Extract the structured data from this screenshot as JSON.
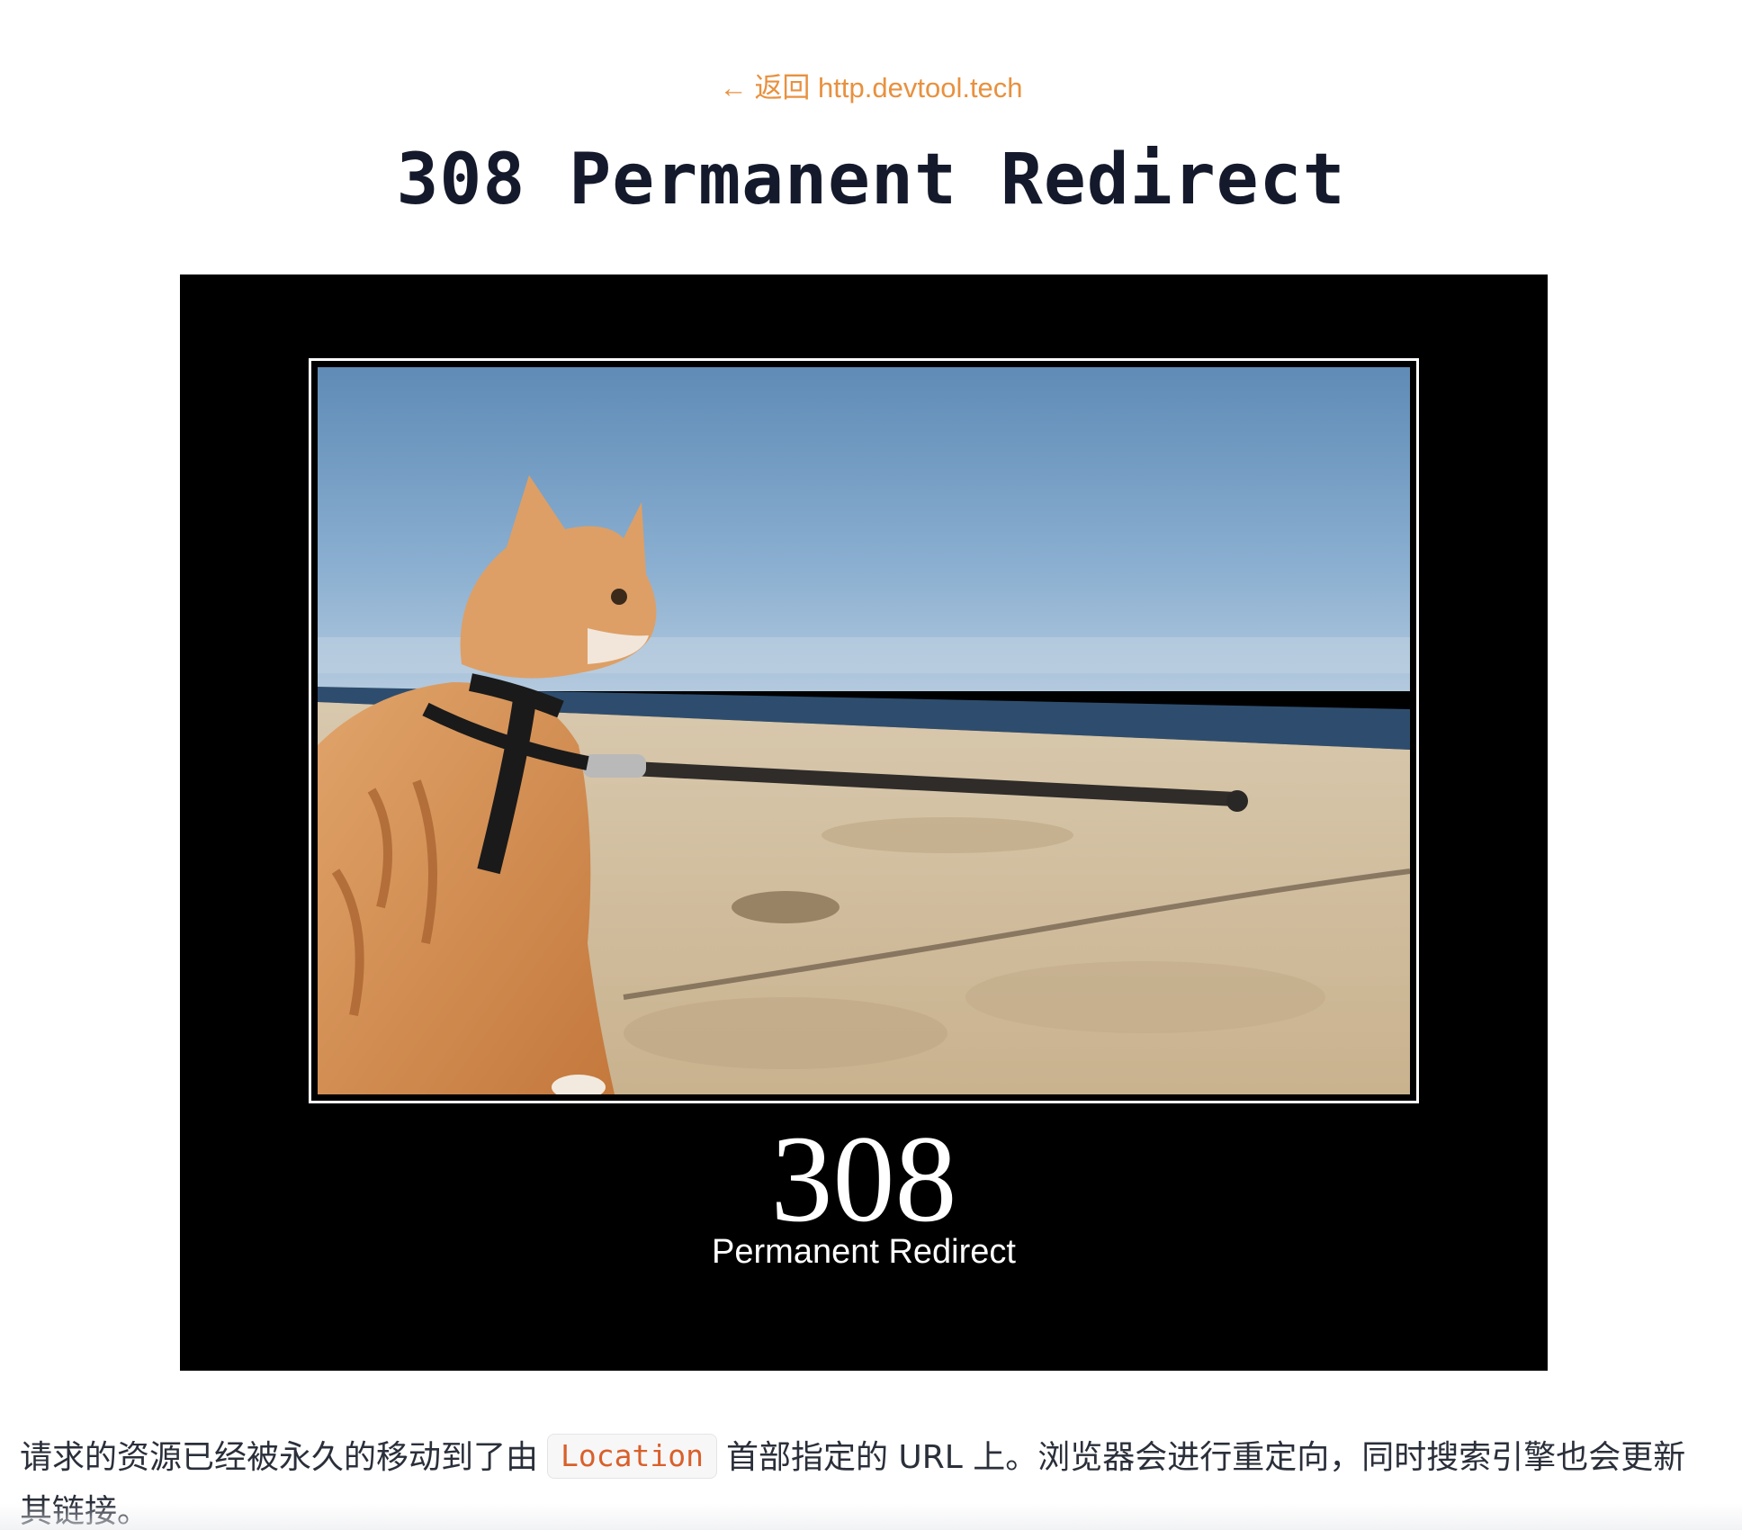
{
  "nav": {
    "back_arrow": "←",
    "back_label": "返回 http.devtool.tech"
  },
  "page": {
    "title": "308 Permanent Redirect"
  },
  "poster": {
    "code": "308",
    "caption": "Permanent Redirect",
    "photo_subject": "cat on leash at beach"
  },
  "description": {
    "before": "请求的资源已经被永久的移动到了由",
    "code": "Location",
    "after": "首部指定的 URL 上。浏览器会进行重定向，同时搜索引擎也会更新其链接。"
  },
  "colors": {
    "link": "#e8913f",
    "title": "#141a2b",
    "code_text": "#d9602b",
    "poster_bg": "#000000"
  }
}
